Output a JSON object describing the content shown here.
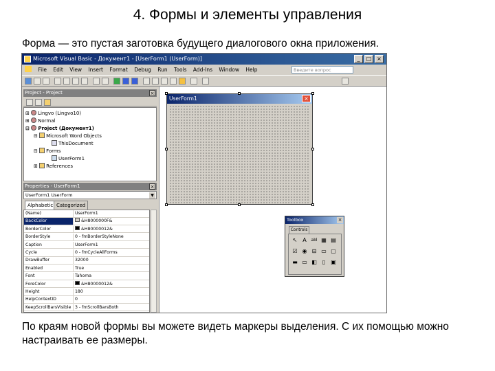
{
  "slide": {
    "title": "4. Формы и элементы управления",
    "intro": "Форма — это пустая заготовка будущего диалогового окна приложения.",
    "footer": "По краям новой формы вы можете видеть маркеры выделения. С их помощью можно настраивать ее размеры."
  },
  "vbe": {
    "window_title": "Microsoft Visual Basic - Документ1 - [UserForm1 (UserForm)]",
    "title_buttons": [
      "_",
      "□",
      "×"
    ],
    "menu": [
      "File",
      "Edit",
      "View",
      "Insert",
      "Format",
      "Debug",
      "Run",
      "Tools",
      "Add-Ins",
      "Window",
      "Help"
    ],
    "ask_placeholder": "Введите вопрос",
    "project_pane": {
      "title": "Project - Project",
      "close": "×",
      "tree": [
        "Lingvo (Lingvo10)",
        "Normal",
        "Project (Документ1)",
        "Microsoft Word Objects",
        "ThisDocument",
        "Forms",
        "UserForm1",
        "References"
      ],
      "expanders": [
        "⊞",
        "⊞",
        "⊟",
        "⊟",
        "⊟",
        "⊞"
      ]
    },
    "properties_pane": {
      "title": "Properties - UserForm1",
      "close": "×",
      "object": "UserForm1 UserForm",
      "tabs": [
        "Alphabetic",
        "Categorized"
      ],
      "rows": [
        {
          "name": "(Name)",
          "value": "UserForm1"
        },
        {
          "name": "BackColor",
          "value": "&H8000000F&"
        },
        {
          "name": "BorderColor",
          "value": "&H80000012&"
        },
        {
          "name": "BorderStyle",
          "value": "0 - fmBorderStyleNone"
        },
        {
          "name": "Caption",
          "value": "UserForm1"
        },
        {
          "name": "Cycle",
          "value": "0 - fmCycleAllForms"
        },
        {
          "name": "DrawBuffer",
          "value": "32000"
        },
        {
          "name": "Enabled",
          "value": "True"
        },
        {
          "name": "Font",
          "value": "Tahoma"
        },
        {
          "name": "ForeColor",
          "value": "&H80000012&"
        },
        {
          "name": "Height",
          "value": "180"
        },
        {
          "name": "HelpContextID",
          "value": "0"
        },
        {
          "name": "KeepScrollBarsVisible",
          "value": "3 - fmScrollBarsBoth"
        }
      ]
    },
    "userform": {
      "caption": "UserForm1",
      "close": "×"
    },
    "toolbox": {
      "title": "Toolbox",
      "close": "×",
      "tab": "Controls",
      "tools": [
        "↖",
        "A",
        "abl",
        "▦",
        "▤",
        "☑",
        "◉",
        "⊟",
        "▭",
        "▢",
        "▬",
        "▭",
        "◧",
        "▯",
        "▣"
      ]
    }
  },
  "colors": {
    "titlebar_start": "#0a246a",
    "titlebar_end": "#3a6ea5",
    "face": "#d4d0c8",
    "close_red": "#e0503a"
  }
}
